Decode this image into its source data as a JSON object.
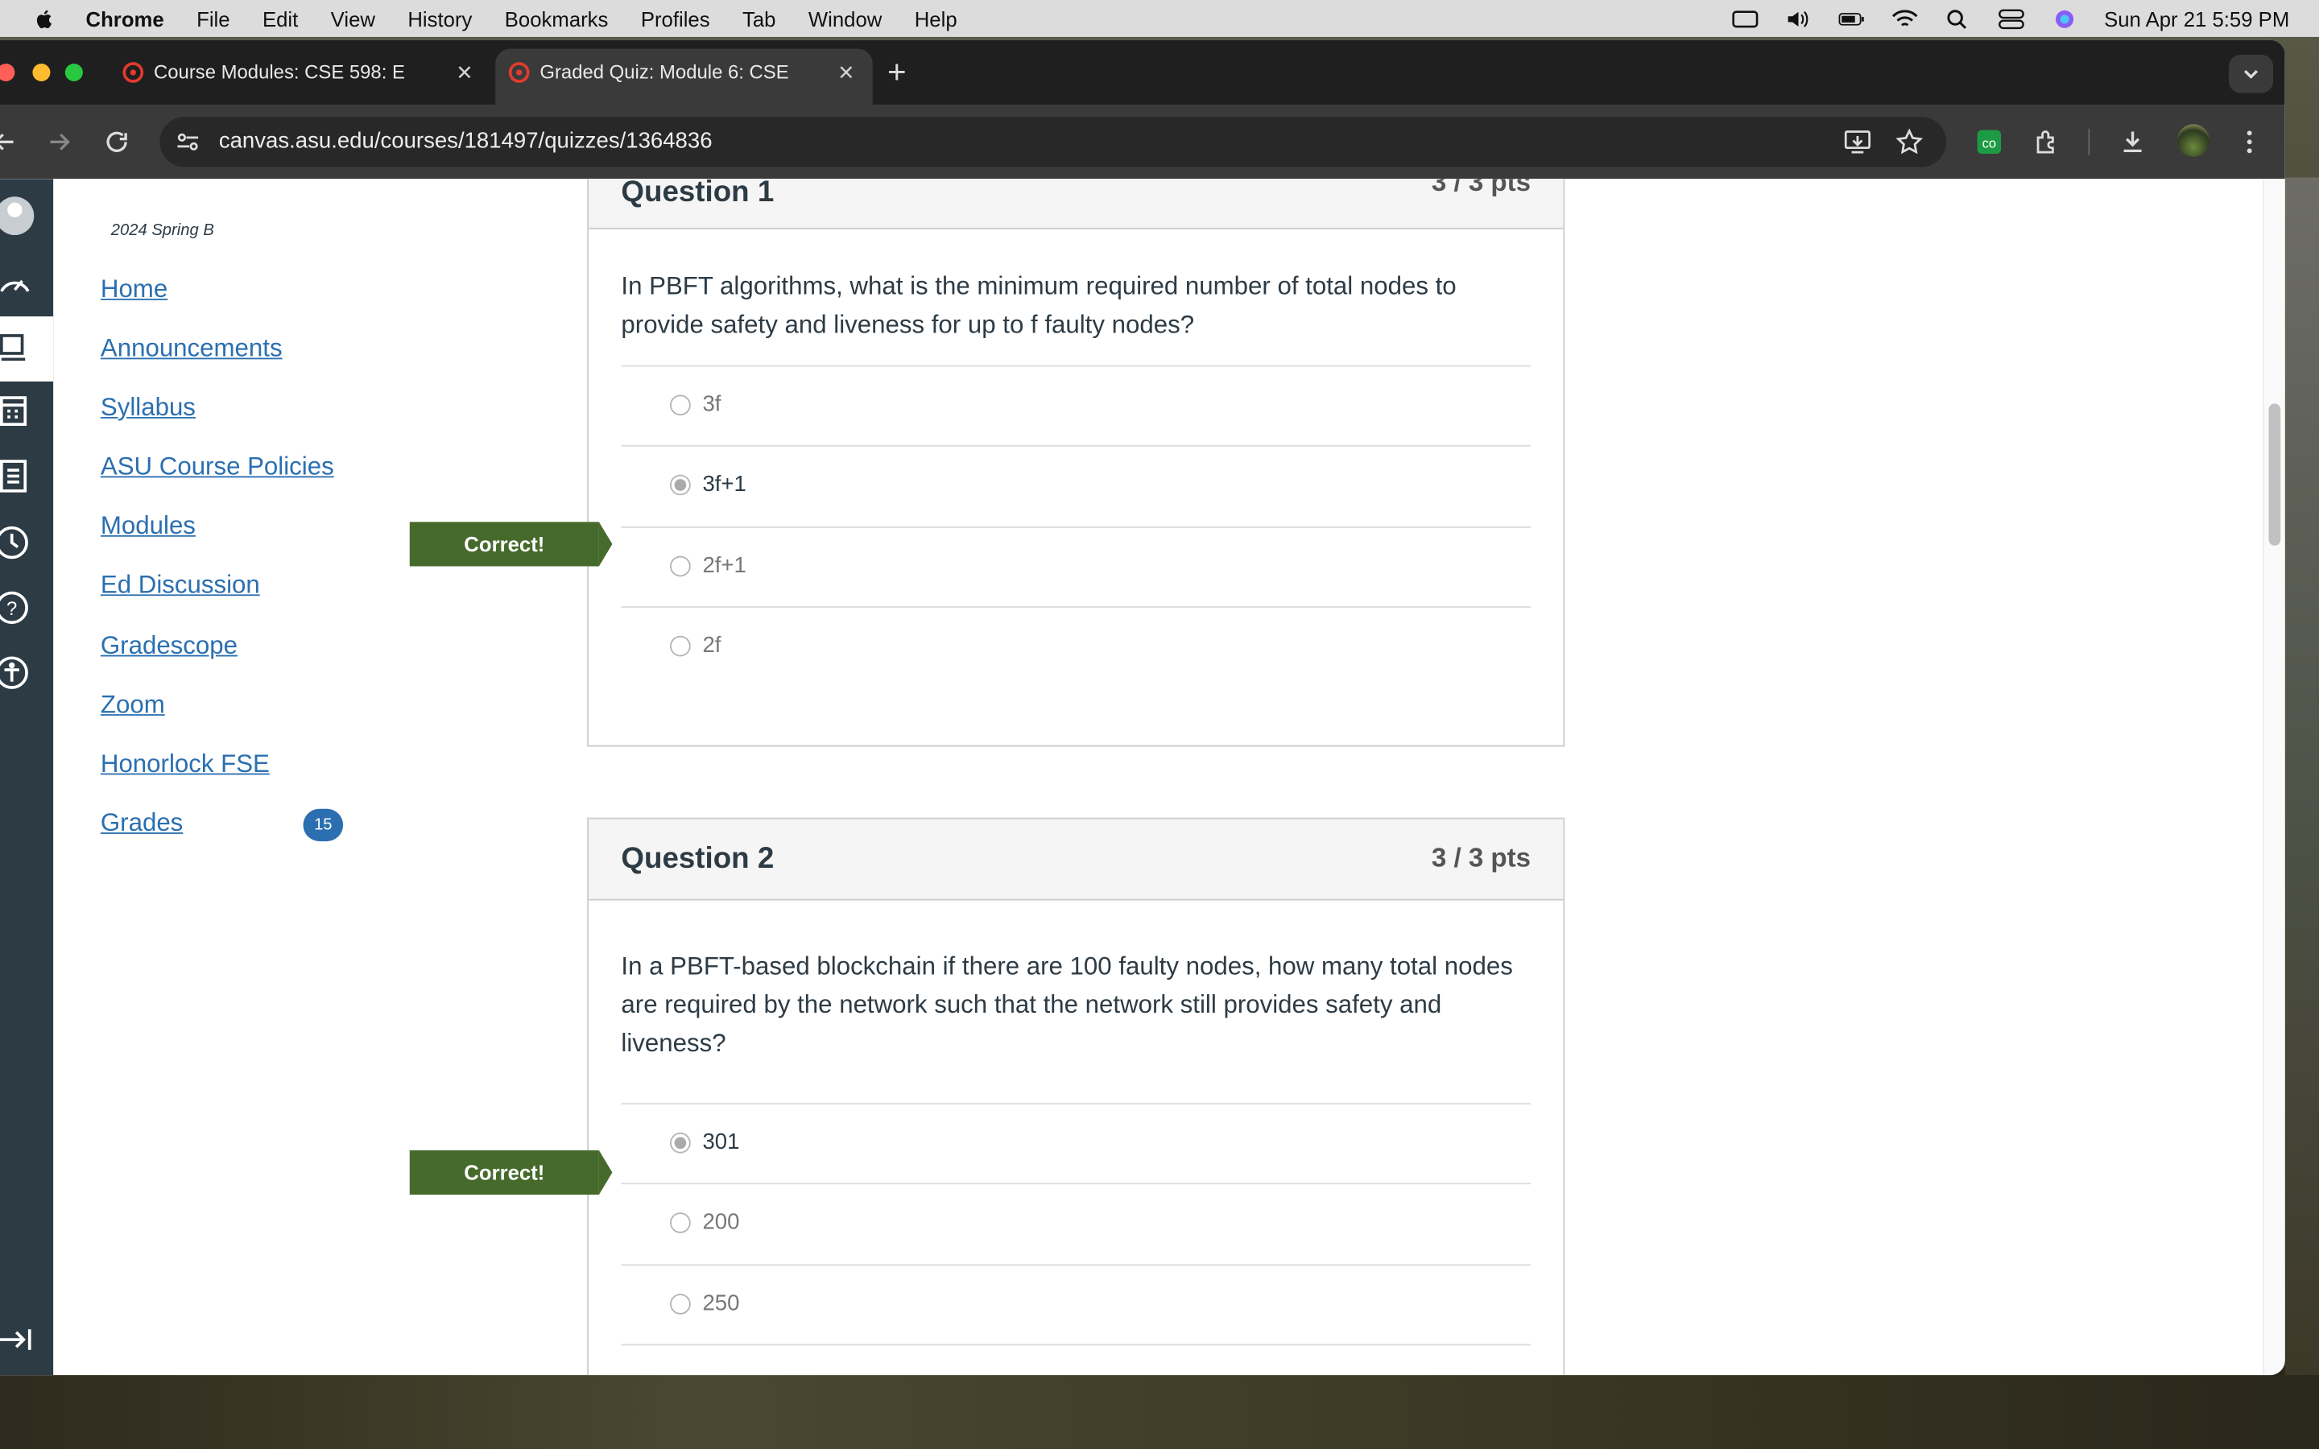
{
  "menubar": {
    "app": "Chrome",
    "items": [
      "File",
      "Edit",
      "View",
      "History",
      "Bookmarks",
      "Profiles",
      "Tab",
      "Window",
      "Help"
    ],
    "datetime": "Sun Apr 21  5:59 PM"
  },
  "tabs": [
    {
      "title": "Course Modules: CSE 598: E"
    },
    {
      "title": "Graded Quiz: Module 6: CSE"
    }
  ],
  "address_bar": {
    "url": "canvas.asu.edu/courses/181497/quizzes/1364836"
  },
  "course_nav": {
    "term": "2024 Spring B",
    "links": [
      "Home",
      "Announcements",
      "Syllabus",
      "ASU Course Policies",
      "Modules",
      "Ed Discussion",
      "Gradescope",
      "Zoom",
      "Honorlock FSE",
      "Grades"
    ],
    "grades_badge": "15"
  },
  "questions": [
    {
      "title": "Question 1",
      "points": "3 / 3 pts",
      "text": "In PBFT algorithms, what is the minimum required number of total nodes to provide safety and liveness for up to f faulty nodes?",
      "answers": [
        "3f",
        "3f+1",
        "2f+1",
        "2f"
      ],
      "selected_index": 1,
      "flag": "Correct!"
    },
    {
      "title": "Question 2",
      "points": "3 / 3 pts",
      "text": "In a PBFT-based blockchain if there are 100 faulty nodes, how many total nodes are required by the network such that the network still provides safety and liveness?",
      "answers": [
        "301",
        "200",
        "250"
      ],
      "selected_index": 0,
      "flag": "Correct!"
    }
  ]
}
